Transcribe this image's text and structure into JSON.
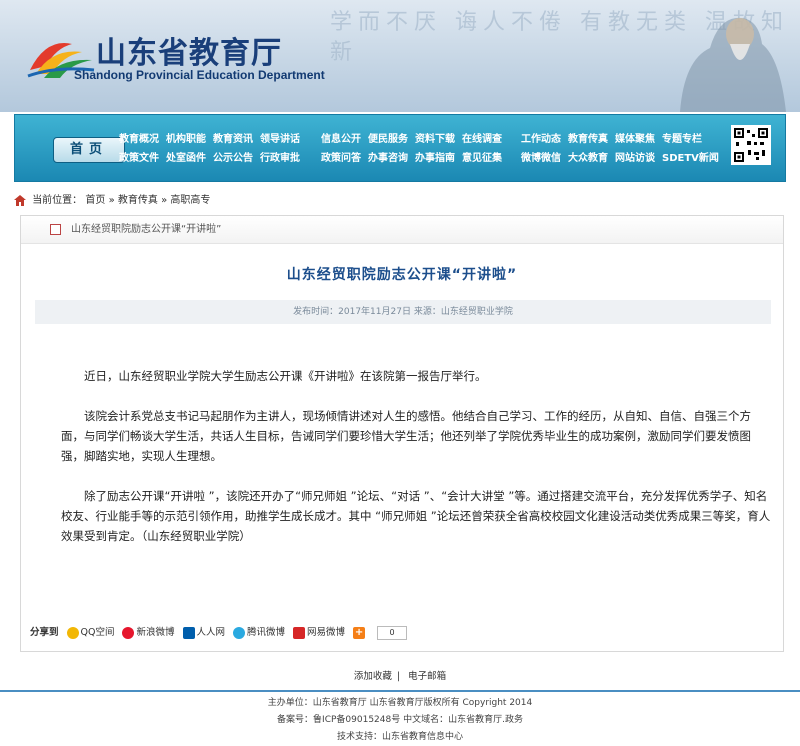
{
  "site": {
    "title": "山东省教育厅",
    "subtitle": "Shandong Provincial Education Department",
    "calligraphy": "学而不厌 诲人不倦 有教无类 温故知新"
  },
  "nav": {
    "home": "首页",
    "group1": [
      "教育概况",
      "机构职能",
      "教育资讯",
      "领导讲话",
      "政策文件",
      "处室函件",
      "公示公告",
      "行政审批"
    ],
    "group2": [
      "信息公开",
      "便民服务",
      "资料下载",
      "在线调查",
      "政策问答",
      "办事咨询",
      "办事指南",
      "意见征集"
    ],
    "group3": [
      "工作动态",
      "教育传真",
      "媒体聚焦",
      "专题专栏",
      "微博微信",
      "大众教育",
      "网站访谈",
      "SDETV新闻"
    ]
  },
  "breadcrumb": {
    "label": "当前位置：",
    "items": [
      "首页",
      "教育传真",
      "高职高专"
    ],
    "sep": "»"
  },
  "article": {
    "header_title": "山东经贸职院励志公开课“开讲啦”",
    "title": "山东经贸职院励志公开课“开讲啦”",
    "meta": "发布时间：2017年11月27日  来源：山东经贸职业学院",
    "paragraphs": [
      "近日，山东经贸职业学院大学生励志公开课《开讲啦》在该院第一报告厅举行。",
      "该院会计系党总支书记马起朋作为主讲人，现场倾情讲述对人生的感悟。他结合自己学习、工作的经历，从自知、自信、自强三个方面，与同学们畅谈大学生活，共话人生目标，告诫同学们要珍惜大学生活；他还列举了学院优秀毕业生的成功案例，激励同学们要发愤图强，脚踏实地，实现人生理想。",
      "除了励志公开课“开讲啦 ”，该院还开办了“师兄师姐 ”论坛、“对话 ”、“会计大讲堂 ”等。通过搭建交流平台，充分发挥优秀学子、知名校友、行业能手等的示范引领作用，助推学生成长成才。其中 “师兄师姐 ”论坛还曾荣获全省高校校园文化建设活动类优秀成果三等奖，育人效果受到肯定。（山东经贸职业学院）"
    ]
  },
  "share": {
    "label": "分享到",
    "items": [
      {
        "name": "QQ空间",
        "color": "#f2b705"
      },
      {
        "name": "新浪微博",
        "color": "#e6162d"
      },
      {
        "name": "人人网",
        "color": "#005eac"
      },
      {
        "name": "腾讯微博",
        "color": "#2aa9e0"
      },
      {
        "name": "网易微博",
        "color": "#d62727"
      }
    ],
    "count": "0"
  },
  "footer": {
    "links": [
      "添加收藏",
      "电子邮箱"
    ],
    "line1": "主办单位：山东省教育厅 山东省教育厅版权所有 Copyright 2014",
    "line2": "备案号：鲁ICP备09015248号 中文域名：山东省教育厅.政务",
    "line3": "技术支持：山东省教育信息中心"
  }
}
